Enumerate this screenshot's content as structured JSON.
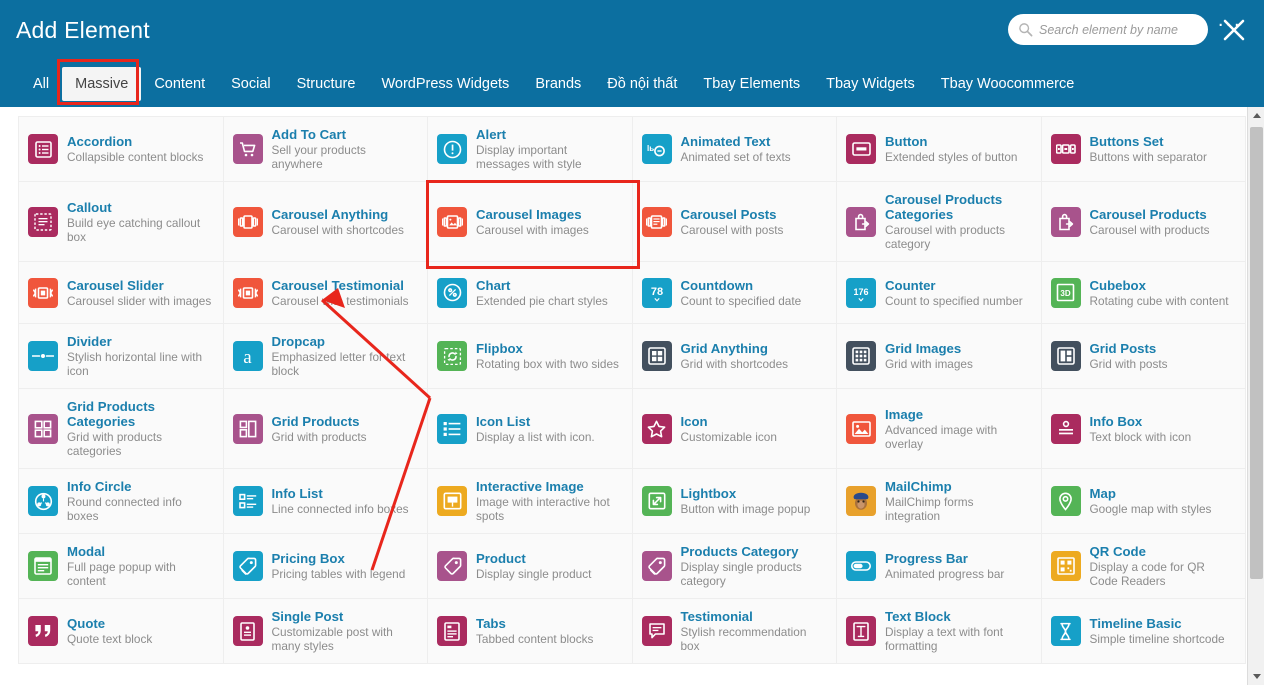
{
  "header": {
    "title": "Add Element",
    "search_placeholder": "Search element by name",
    "search_value": "",
    "search_icon": "search-icon",
    "close_icon": "close-icon",
    "more_tabs_label": "...",
    "accent_color": "#0c6fa0",
    "highlight_color": "#e8261c"
  },
  "tabs": [
    {
      "label": "All",
      "active": false
    },
    {
      "label": "Massive",
      "active": true
    },
    {
      "label": "Content",
      "active": false
    },
    {
      "label": "Social",
      "active": false
    },
    {
      "label": "Structure",
      "active": false
    },
    {
      "label": "WordPress Widgets",
      "active": false
    },
    {
      "label": "Brands",
      "active": false
    },
    {
      "label": "Đồ nội thất",
      "active": false
    },
    {
      "label": "Tbay Elements",
      "active": false
    },
    {
      "label": "Tbay Widgets",
      "active": false
    },
    {
      "label": "Tbay Woocommerce",
      "active": false
    }
  ],
  "elements": [
    {
      "name": "Accordion",
      "desc": "Collapsible content blocks",
      "icon": "list-icon",
      "color": "#aa2b5f",
      "selected": false
    },
    {
      "name": "Add To Cart",
      "desc": "Sell your products anywhere",
      "icon": "cart-icon",
      "color": "#a8538c",
      "selected": false
    },
    {
      "name": "Alert",
      "desc": "Display important messages with style",
      "icon": "exclamation-circle-icon",
      "color": "#16a0c8",
      "selected": false
    },
    {
      "name": "Animated Text",
      "desc": "Animated set of texts",
      "icon": "animated-text-icon",
      "color": "#16a0c8",
      "selected": false
    },
    {
      "name": "Button",
      "desc": "Extended styles of button",
      "icon": "button-icon",
      "color": "#aa2b5f",
      "selected": false
    },
    {
      "name": "Buttons Set",
      "desc": "Buttons with separator",
      "icon": "buttons-set-icon",
      "color": "#aa2b5f",
      "selected": false
    },
    {
      "name": "Callout",
      "desc": "Build eye catching callout box",
      "icon": "callout-icon",
      "color": "#aa2b5f",
      "selected": false
    },
    {
      "name": "Carousel Anything",
      "desc": "Carousel with shortcodes",
      "icon": "carousel-icon",
      "color": "#f0563c",
      "selected": false
    },
    {
      "name": "Carousel Images",
      "desc": "Carousel with images",
      "icon": "carousel-image-icon",
      "color": "#f0563c",
      "selected": true
    },
    {
      "name": "Carousel Posts",
      "desc": "Carousel with posts",
      "icon": "carousel-post-icon",
      "color": "#f0563c",
      "selected": false
    },
    {
      "name": "Carousel Products Categories",
      "desc": "Carousel with products category",
      "icon": "bag-arrow-icon",
      "color": "#a8538c",
      "selected": false
    },
    {
      "name": "Carousel Products",
      "desc": "Carousel with products",
      "icon": "bag-arrow-icon",
      "color": "#a8538c",
      "selected": false
    },
    {
      "name": "Carousel Slider",
      "desc": "Carousel slider with images",
      "icon": "slider-icon",
      "color": "#f0563c",
      "selected": false
    },
    {
      "name": "Carousel Testimonial",
      "desc": "Carousel with testimonials",
      "icon": "slider-icon",
      "color": "#f0563c",
      "selected": false
    },
    {
      "name": "Chart",
      "desc": "Extended pie chart styles",
      "icon": "pie-chart-icon",
      "color": "#16a0c8",
      "selected": false
    },
    {
      "name": "Countdown",
      "desc": "Count to specified date",
      "icon": "countdown-78-icon",
      "color": "#16a0c8",
      "selected": false,
      "icon_text": "78"
    },
    {
      "name": "Counter",
      "desc": "Count to specified number",
      "icon": "counter-176-icon",
      "color": "#16a0c8",
      "selected": false,
      "icon_text": "176"
    },
    {
      "name": "Cubebox",
      "desc": "Rotating cube with content",
      "icon": "cube-3d-icon",
      "color": "#54b456",
      "selected": false,
      "icon_text": "3D"
    },
    {
      "name": "Divider",
      "desc": "Stylish horizontal line with icon",
      "icon": "divider-icon",
      "color": "#16a0c8",
      "selected": false
    },
    {
      "name": "Dropcap",
      "desc": "Emphasized letter for text block",
      "icon": "dropcap-a-icon",
      "color": "#16a0c8",
      "selected": false,
      "icon_text": "a"
    },
    {
      "name": "Flipbox",
      "desc": "Rotating box with two sides",
      "icon": "flip-icon",
      "color": "#54b456",
      "selected": false
    },
    {
      "name": "Grid Anything",
      "desc": "Grid with shortcodes",
      "icon": "grid-icon",
      "color": "#43505e",
      "selected": false
    },
    {
      "name": "Grid Images",
      "desc": "Grid with images",
      "icon": "grid-dots-icon",
      "color": "#43505e",
      "selected": false
    },
    {
      "name": "Grid Posts",
      "desc": "Grid with posts",
      "icon": "grid-posts-icon",
      "color": "#43505e",
      "selected": false
    },
    {
      "name": "Grid Products Categories",
      "desc": "Grid with products categories",
      "icon": "grid-products-cat-icon",
      "color": "#a8538c",
      "selected": false
    },
    {
      "name": "Grid Products",
      "desc": "Grid with products",
      "icon": "grid-products-icon",
      "color": "#a8538c",
      "selected": false
    },
    {
      "name": "Icon List",
      "desc": "Display a list with icon.",
      "icon": "icon-list-icon",
      "color": "#16a0c8",
      "selected": false
    },
    {
      "name": "Icon",
      "desc": "Customizable icon",
      "icon": "star-icon",
      "color": "#aa2b5f",
      "selected": false
    },
    {
      "name": "Image",
      "desc": "Advanced image with overlay",
      "icon": "image-icon",
      "color": "#f0563c",
      "selected": false
    },
    {
      "name": "Info Box",
      "desc": "Text block with icon",
      "icon": "info-box-icon",
      "color": "#aa2b5f",
      "selected": false
    },
    {
      "name": "Info Circle",
      "desc": "Round connected info boxes",
      "icon": "info-circle-icon",
      "color": "#16a0c8",
      "selected": false
    },
    {
      "name": "Info List",
      "desc": "Line connected info boxes",
      "icon": "info-list-icon",
      "color": "#16a0c8",
      "selected": false
    },
    {
      "name": "Interactive Image",
      "desc": "Image with interactive hot spots",
      "icon": "interactive-image-icon",
      "color": "#edaa20",
      "selected": false
    },
    {
      "name": "Lightbox",
      "desc": "Button with image popup",
      "icon": "expand-icon",
      "color": "#54b456",
      "selected": false
    },
    {
      "name": "MailChimp",
      "desc": "MailChimp forms integration",
      "icon": "mailchimp-monkey-icon",
      "color": "#e8a12c",
      "selected": false
    },
    {
      "name": "Map",
      "desc": "Google map with styles",
      "icon": "map-pin-icon",
      "color": "#54b456",
      "selected": false
    },
    {
      "name": "Modal",
      "desc": "Full page popup with content",
      "icon": "modal-icon",
      "color": "#54b456",
      "selected": false
    },
    {
      "name": "Pricing Box",
      "desc": "Pricing tables with legend",
      "icon": "price-tag-icon",
      "color": "#16a0c8",
      "selected": false
    },
    {
      "name": "Product",
      "desc": "Display single product",
      "icon": "tag-icon",
      "color": "#a8538c",
      "selected": false
    },
    {
      "name": "Products Category",
      "desc": "Display single products category",
      "icon": "products-category-icon",
      "color": "#a8538c",
      "selected": false
    },
    {
      "name": "Progress Bar",
      "desc": "Animated progress bar",
      "icon": "progress-bar-icon",
      "color": "#16a0c8",
      "selected": false
    },
    {
      "name": "QR Code",
      "desc": "Display a code for QR Code Readers",
      "icon": "qr-code-icon",
      "color": "#edaa20",
      "selected": false
    },
    {
      "name": "Quote",
      "desc": "Quote text block",
      "icon": "quote-icon",
      "color": "#aa2b5f",
      "selected": false
    },
    {
      "name": "Single Post",
      "desc": "Customizable post with many styles",
      "icon": "single-post-icon",
      "color": "#aa2b5f",
      "selected": false
    },
    {
      "name": "Tabs",
      "desc": "Tabbed content blocks",
      "icon": "tabs-icon",
      "color": "#aa2b5f",
      "selected": false
    },
    {
      "name": "Testimonial",
      "desc": "Stylish recommendation box",
      "icon": "speech-bubble-icon",
      "color": "#aa2b5f",
      "selected": false
    },
    {
      "name": "Text Block",
      "desc": "Display a text with font formatting",
      "icon": "text-block-icon",
      "color": "#aa2b5f",
      "selected": false
    },
    {
      "name": "Timeline Basic",
      "desc": "Simple timeline shortcode",
      "icon": "hourglass-icon",
      "color": "#16a0c8",
      "selected": false
    }
  ],
  "scrollbar": {
    "up_icon": "scroll-up-arrow-icon",
    "down_icon": "scroll-down-arrow-icon"
  },
  "annotation": {
    "type": "red-arrow",
    "from": "modal-cell",
    "to": "carousel-images-cell",
    "color": "#e8261c"
  }
}
